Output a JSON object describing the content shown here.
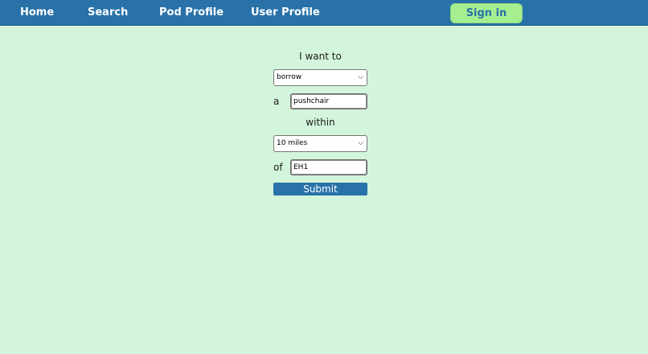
{
  "nav": {
    "home": "Home",
    "search": "Search",
    "pod_profile": "Pod Profile",
    "user_profile": "User Profile",
    "sign_in": "Sign in"
  },
  "form": {
    "intro": "I want to",
    "verb_selected": "borrow",
    "article": "a",
    "item_value": "pushchair",
    "within": "within",
    "distance_selected": "10 miles",
    "of": "of",
    "location_value": "EH1",
    "submit": "Submit"
  },
  "colors": {
    "background": "#d3f5dc",
    "navbar": "#2872a9",
    "sign_in_button": "#a6ef91",
    "submit_button": "#2872a9"
  },
  "icons": {
    "select_arrow": "chevron-down-icon"
  }
}
